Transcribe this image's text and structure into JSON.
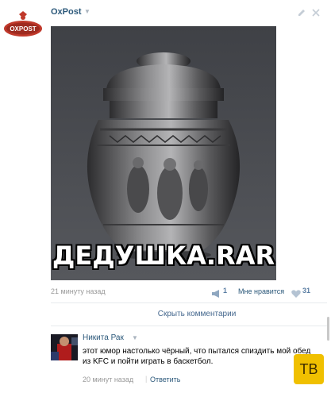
{
  "post": {
    "author": "OxPost",
    "avatar_text": "OXPOST",
    "image_caption": "ДЕДУШКА.RAR",
    "time": "21 минуту назад",
    "shares_count": "1",
    "like_label": "Мне нравится",
    "likes_count": "31"
  },
  "comments_toggle": "Скрыть комментарии",
  "comment": {
    "author": "Никита Рак",
    "text": "этот юмор настолько чёрный, что пытался спиздить мой обед из KFC и пойти играть в баскетбол.",
    "time": "20 минут назад",
    "separator": "|",
    "reply_label": "Ответить"
  },
  "badge": {
    "text": "ТВ"
  },
  "colors": {
    "link": "#2b587a",
    "muted": "#999999",
    "accent_badge": "#f0c000",
    "image_bg": "#4a4c51"
  }
}
